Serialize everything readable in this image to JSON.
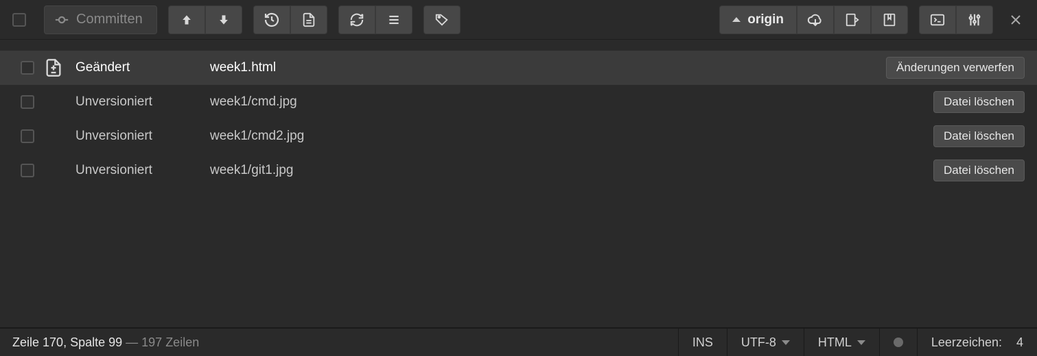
{
  "toolbar": {
    "commit_label": "Committen",
    "remote_label": "origin"
  },
  "files": [
    {
      "status": "Geändert",
      "path": "week1.html",
      "action": "Änderungen verwerfen",
      "selected": true,
      "icon": true
    },
    {
      "status": "Unversioniert",
      "path": "week1/cmd.jpg",
      "action": "Datei löschen",
      "selected": false,
      "icon": false
    },
    {
      "status": "Unversioniert",
      "path": "week1/cmd2.jpg",
      "action": "Datei löschen",
      "selected": false,
      "icon": false
    },
    {
      "status": "Unversioniert",
      "path": "week1/git1.jpg",
      "action": "Datei löschen",
      "selected": false,
      "icon": false
    }
  ],
  "statusbar": {
    "cursor_prefix": "Zeile ",
    "line": "170",
    "cursor_mid": ", Spalte ",
    "col": "99",
    "sep": " — ",
    "total_lines": "197 Zeilen",
    "ins": "INS",
    "encoding": "UTF-8",
    "language": "HTML",
    "indent_label": "Leerzeichen:",
    "indent_size": "4"
  }
}
